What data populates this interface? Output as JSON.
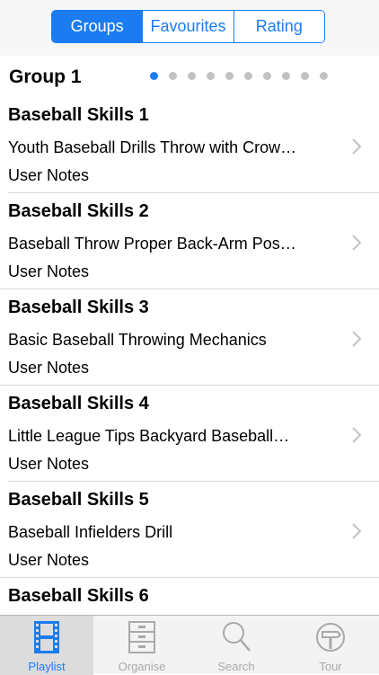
{
  "segmented": {
    "items": [
      {
        "label": "Groups",
        "active": true
      },
      {
        "label": "Favourites",
        "active": false
      },
      {
        "label": "Rating",
        "active": false
      }
    ]
  },
  "group": {
    "title": "Group 1",
    "pager": {
      "pages": 10,
      "current": 1
    }
  },
  "list": {
    "items": [
      {
        "title": "Baseball Skills 1",
        "subtitle": "Youth Baseball Drills Throw with Crow…",
        "notes": "User Notes"
      },
      {
        "title": "Baseball Skills 2",
        "subtitle": "Baseball Throw Proper Back-Arm Pos…",
        "notes": "User Notes"
      },
      {
        "title": "Baseball Skills 3",
        "subtitle": "Basic Baseball Throwing Mechanics",
        "notes": "User Notes"
      },
      {
        "title": "Baseball Skills 4",
        "subtitle": "Little League Tips Backyard Baseball…",
        "notes": "User Notes"
      },
      {
        "title": "Baseball Skills 5",
        "subtitle": "Baseball Infielders Drill",
        "notes": "User Notes"
      },
      {
        "title": "Baseball Skills 6"
      }
    ]
  },
  "tabbar": {
    "items": [
      {
        "label": "Playlist",
        "icon": "film-strip-icon",
        "active": true
      },
      {
        "label": "Organise",
        "icon": "cabinet-icon",
        "active": false
      },
      {
        "label": "Search",
        "icon": "magnifier-icon",
        "active": false
      },
      {
        "label": "Tour",
        "icon": "signpost-icon",
        "active": false
      }
    ]
  },
  "colors": {
    "accent": "#1a7cf0",
    "inactive": "#a9a9a9",
    "separator": "#d8d8d8"
  }
}
